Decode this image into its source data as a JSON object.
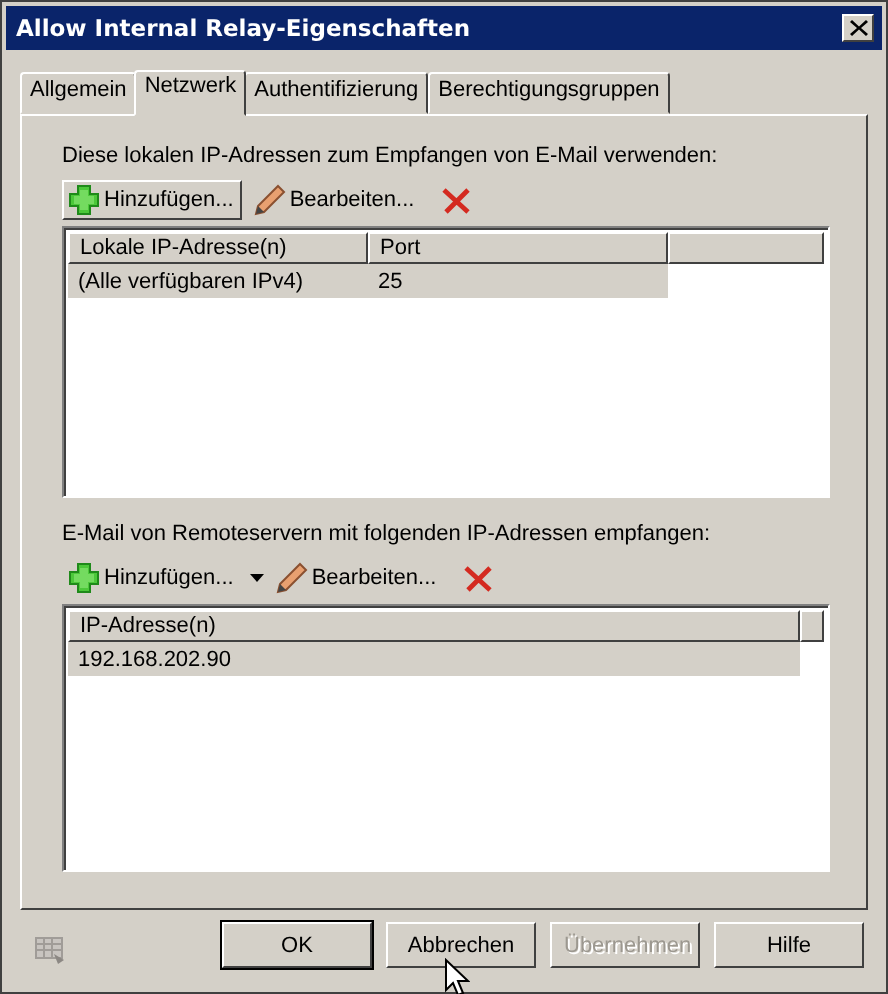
{
  "window": {
    "title": "Allow Internal Relay-Eigenschaften"
  },
  "tabs": [
    {
      "label": "Allgemein",
      "selected": false
    },
    {
      "label": "Netzwerk",
      "selected": true
    },
    {
      "label": "Authentifizierung",
      "selected": false
    },
    {
      "label": "Berechtigungsgruppen",
      "selected": false
    }
  ],
  "sections": [
    {
      "label": "Diese lokalen IP-Adressen zum Empfangen von E-Mail verwenden:",
      "toolbar": [
        {
          "kind": "add",
          "label": "Hinzufügen...",
          "raised": true,
          "dropdown": false
        },
        {
          "kind": "edit",
          "label": "Bearbeiten..."
        },
        {
          "kind": "delete"
        }
      ],
      "table": {
        "columns": [
          "Lokale IP-Adresse(n)",
          "Port"
        ],
        "rows": [
          {
            "cells": [
              "(Alle verfügbaren IPv4)",
              "25"
            ],
            "selected": true
          }
        ]
      }
    },
    {
      "label": "E-Mail von Remoteservern mit folgenden IP-Adressen empfangen:",
      "toolbar": [
        {
          "kind": "add",
          "label": "Hinzufügen...",
          "raised": false,
          "dropdown": true
        },
        {
          "kind": "edit",
          "label": "Bearbeiten..."
        },
        {
          "kind": "delete"
        }
      ],
      "table": {
        "columns": [
          "IP-Adresse(n)"
        ],
        "rows": [
          {
            "cells": [
              "192.168.202.90"
            ],
            "selected": true
          }
        ]
      }
    }
  ],
  "buttons": [
    {
      "label": "OK",
      "default": true,
      "disabled": false
    },
    {
      "label": "Abbrechen",
      "default": false,
      "disabled": false
    },
    {
      "label": "Übernehmen",
      "default": false,
      "disabled": true
    },
    {
      "label": "Hilfe",
      "default": false,
      "disabled": false
    }
  ]
}
